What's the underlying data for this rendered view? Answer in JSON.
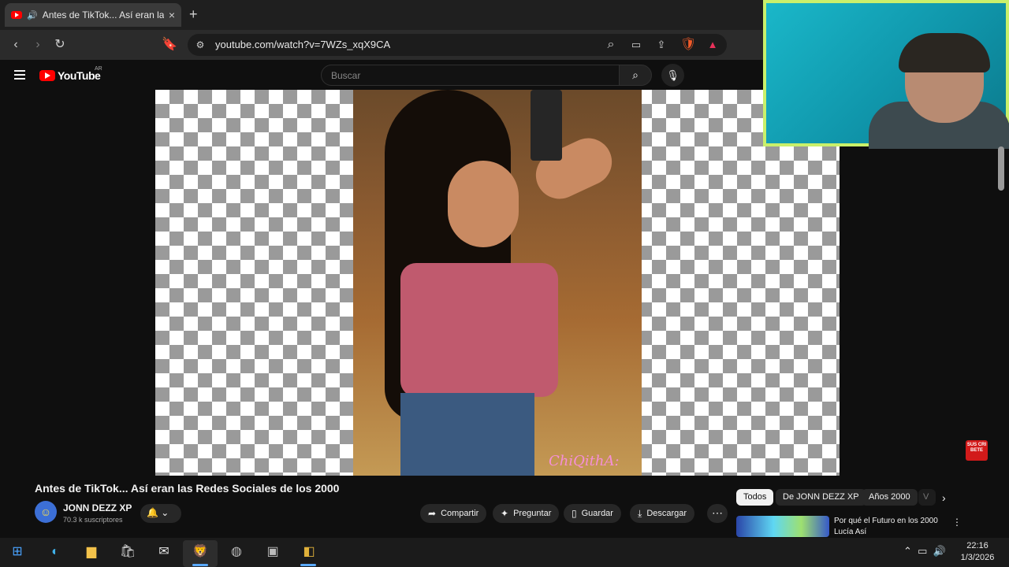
{
  "browser": {
    "tab_title": "Antes de TikTok... Así eran las",
    "tab_close": "×",
    "new_tab": "+",
    "url": "youtube.com/watch?v=7WZs_xqX9CA"
  },
  "youtube": {
    "logo_text": "YouTube",
    "country": "AR",
    "search_placeholder": "Buscar"
  },
  "video": {
    "overlay_text": "ChiQithA:",
    "subscribe_badge": "SUS CRI BETE"
  },
  "meta": {
    "title": "Antes de TikTok... Así eran las Redes Sociales de los 2000",
    "channel_name": "JONN DEZZ XP",
    "subscribers": "70.3 k suscriptores",
    "actions": [
      {
        "icon": "share-icon",
        "label": "Compartir"
      },
      {
        "icon": "sparkle-icon",
        "label": "Preguntar"
      },
      {
        "icon": "bookmark-icon",
        "label": "Guardar"
      },
      {
        "icon": "download-icon",
        "label": "Descargar"
      }
    ],
    "more": "⋯"
  },
  "chips": [
    "Todos",
    "De JONN DEZZ XP",
    "Años 2000",
    "V"
  ],
  "recommendation": {
    "title": "Por qué el Futuro en los 2000",
    "channel": "Lucía Así"
  },
  "taskbar": {
    "time": "22:16",
    "date": "1/3/2026"
  },
  "colors": {
    "youtube_red": "#ff0000",
    "webcam_border": "#c9f06b",
    "background": "#0f0f0f"
  }
}
